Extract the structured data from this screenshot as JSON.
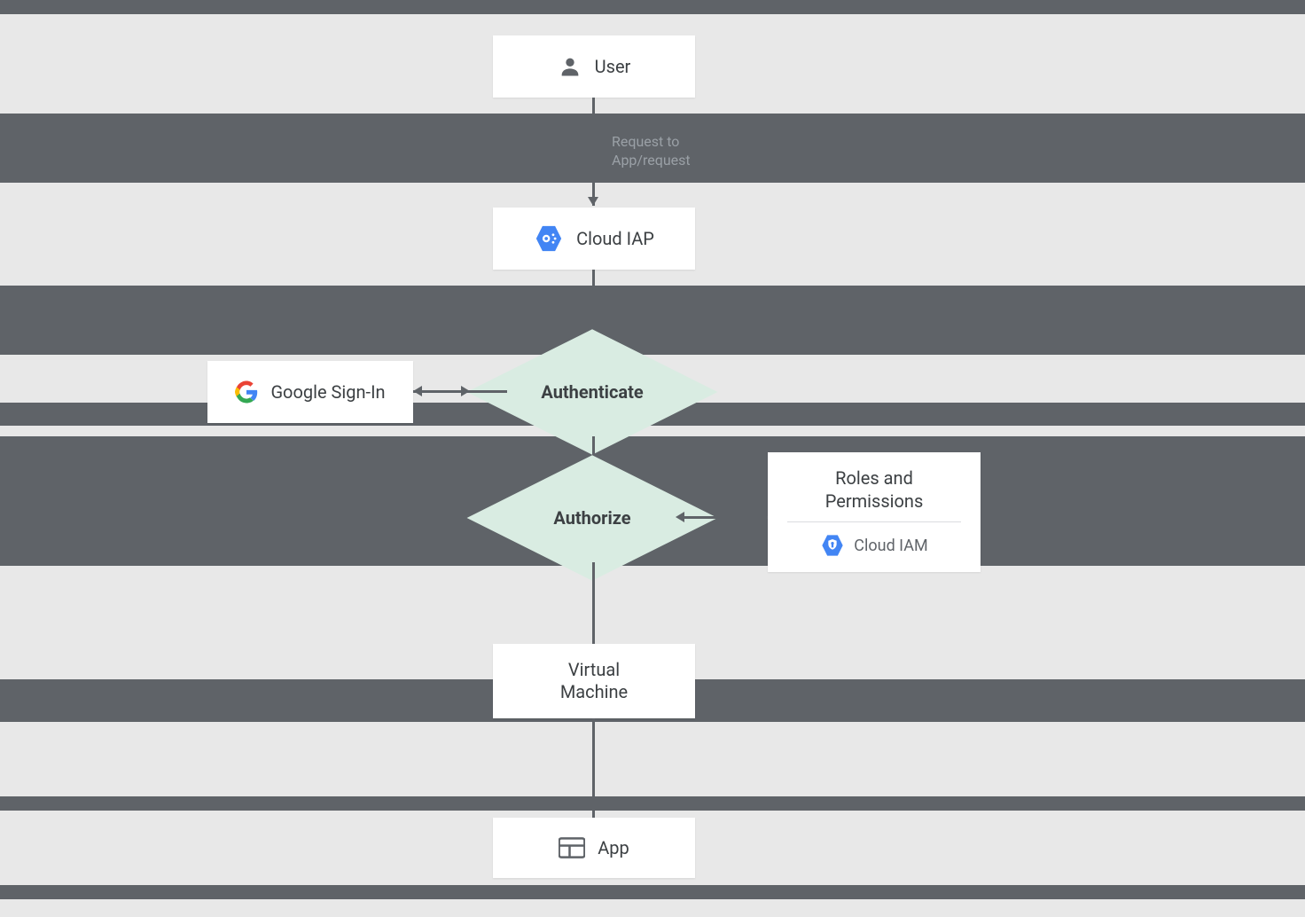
{
  "nodes": {
    "user": "User",
    "cloud_iap": "Cloud IAP",
    "google_signin": "Google Sign-In",
    "authenticate": "Authenticate",
    "authorize": "Authorize",
    "roles_permissions_title": "Roles and Permissions",
    "cloud_iam": "Cloud IAM",
    "virtual_machine": "Virtual\nMachine",
    "app": "App"
  },
  "edges": {
    "request_to_app_l1": "Request to",
    "request_to_app_l2": "App/request"
  },
  "icons": {
    "user": "person-silhouette",
    "cloud_iap": "gcp-hex-iap",
    "google": "google-g",
    "cloud_iam": "gcp-hex-iam-shield",
    "app": "window-layout"
  },
  "colors": {
    "band": "#5f6368",
    "diamond_bg": "#d9ece2",
    "box_bg": "#ffffff",
    "text": "#3c4043",
    "muted": "#9aa0a6",
    "gcp_blue": "#4285f4"
  }
}
